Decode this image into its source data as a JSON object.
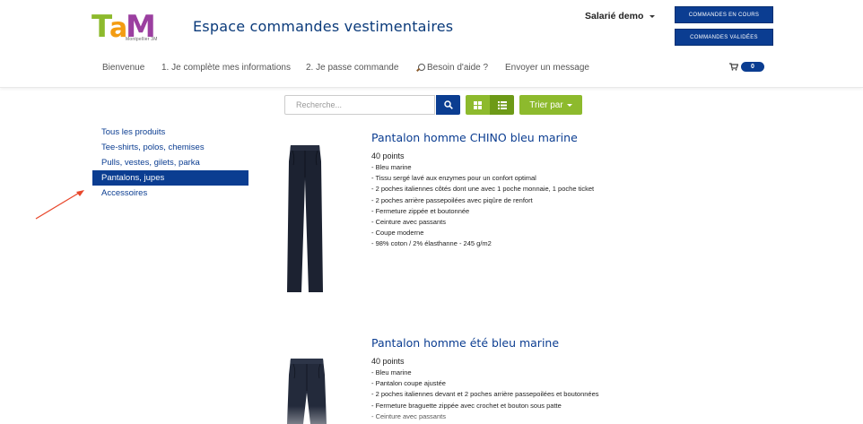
{
  "header": {
    "logo_text": "TaM",
    "logo_subtext": "Montpellier 3M",
    "site_title": "Espace commandes vestimentaires",
    "user_label": "Salarié demo",
    "btn_orders_current": "Commandes en cours",
    "btn_orders_validated": "Commandes validées"
  },
  "nav": {
    "items": [
      "Bienvenue",
      "1. Je complète mes informations",
      "2. Je passe commande",
      "Besoin d'aide ?",
      "Envoyer un message"
    ],
    "cart_count": "0"
  },
  "toolbar": {
    "search_placeholder": "Recherche...",
    "sort_label": "Trier par"
  },
  "sidebar": {
    "categories": [
      "Tous les produits",
      "Tee-shirts, polos, chemises",
      "Pulls, vestes, gilets, parka",
      "Pantalons, jupes",
      "Accessoires"
    ],
    "active_index": 3
  },
  "products": [
    {
      "title": "Pantalon homme CHINO bleu marine",
      "points": "40 points",
      "details": [
        "- Bleu marine",
        "- Tissu sergé lavé aux enzymes pour un confort optimal",
        "- 2 poches italiennes côtés dont une avec 1 poche monnaie, 1 poche ticket",
        "- 2 poches arrière passepoilées avec piqûre de renfort",
        "- Fermeture zippée et boutonnée",
        "- Ceinture avec passants",
        "- Coupe moderne",
        "- 98% coton / 2% élasthanne - 245 g/m2"
      ]
    },
    {
      "title": "Pantalon homme été bleu marine",
      "points": "40 points",
      "details": [
        "- Bleu marine",
        "- Pantalon coupe ajustée",
        "- 2 poches italiennes devant et 2 poches arrière passepoilées et boutonnées",
        "- Fermeture braguette zippée avec crochet et bouton sous patte",
        "- Ceinture avec passants"
      ]
    }
  ],
  "colors": {
    "brand_blue": "#0b3d91",
    "brand_green": "#8dba2d",
    "annotation_red": "#e8472b"
  }
}
